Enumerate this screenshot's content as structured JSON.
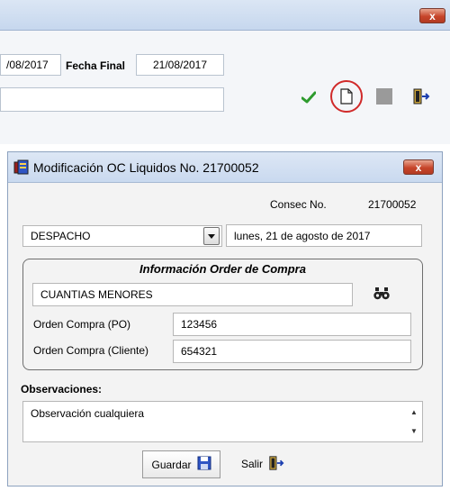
{
  "bg_window": {
    "close_glyph": "x",
    "fecha_inicial_value": "/08/2017",
    "fecha_final_label": "Fecha Final",
    "fecha_final_value": "21/08/2017",
    "text_field_value": "",
    "icons": [
      "check-icon",
      "new-document-icon",
      "stop-icon",
      "exit-door-icon"
    ]
  },
  "dialog": {
    "title": "Modificación OC Liquidos No. 21700052",
    "close_glyph": "x",
    "consec_label": "Consec No.",
    "consec_value": "21700052",
    "tipo_value": "DESPACHO",
    "date_value": "lunes, 21 de agosto de 2017",
    "group_title": "Información Order de Compra",
    "proveedor_value": "CUANTIAS MENORES",
    "oc_po_label": "Orden Compra (PO)",
    "oc_po_value": "123456",
    "oc_cliente_label": "Orden Compra (Cliente)",
    "oc_cliente_value": "654321",
    "observaciones_label": "Observaciones:",
    "observaciones_value": "Observación cualquiera",
    "guardar_label": "Guardar",
    "salir_label": "Salir"
  },
  "colors": {
    "titlebar": "#c9d9ef",
    "close_red": "#c7452a",
    "highlight_circle": "#d02a2a",
    "check_green": "#2e9b2e",
    "save_blue": "#2f55c4"
  }
}
